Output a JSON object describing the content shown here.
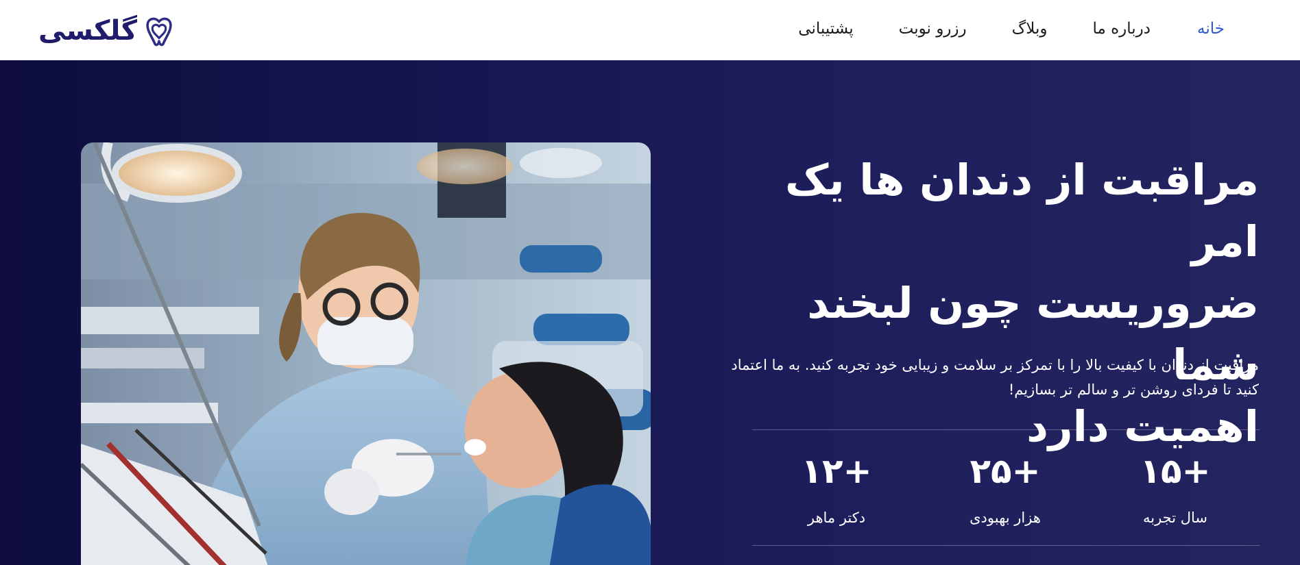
{
  "brand": {
    "name": "گلکسی",
    "logo_icon": "tooth-heart-icon"
  },
  "nav": {
    "items": [
      {
        "label": "خانه",
        "active": true
      },
      {
        "label": "درباره ما",
        "active": false
      },
      {
        "label": "وبلاگ",
        "active": false
      },
      {
        "label": "رزرو نوبت",
        "active": false
      },
      {
        "label": "پشتیبانی",
        "active": false
      }
    ]
  },
  "hero": {
    "headline_lines": [
      "مراقبت از دندان ها یک امر",
      "ضروریست چون لبخند شما",
      "اهمیت دارد"
    ],
    "subtitle": "مراقبت از دندان با کیفیت بالا را با تمرکز بر سلامت و زیبایی خود تجربه کنید. به ما اعتماد کنید تا فردای روشن تر و سالم تر بسازیم!",
    "stats": [
      {
        "value": "۱۵+",
        "label": "سال تجربه"
      },
      {
        "value": "۲۵+",
        "label": "هزار بهبودی"
      },
      {
        "value": "۱۲+",
        "label": "دکتر ماهر"
      }
    ]
  },
  "colors": {
    "brand": "#1f1d6b",
    "nav_active": "#2f58c8",
    "hero_bg_dark": "#0e0d3e",
    "hero_bg_light": "#24245f"
  }
}
